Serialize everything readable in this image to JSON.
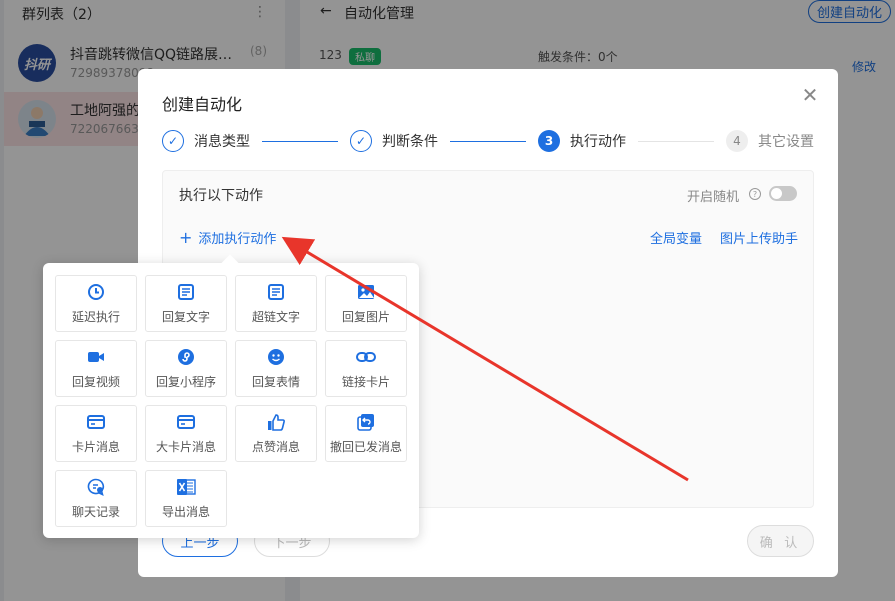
{
  "colors": {
    "accent": "#1e6fe0",
    "annotation_arrow": "#e8352b",
    "tag_green": "#19be6b"
  },
  "left_panel": {
    "title": "群列表（2）",
    "more_icon": "more-icon",
    "groups": [
      {
        "name": "抖音跳转微信QQ链路展…",
        "id": "72989378098",
        "count": "(8)",
        "avatar_text": "抖研"
      },
      {
        "name": "工地阿强的",
        "id": "72206766308",
        "count": ""
      }
    ]
  },
  "right_panel": {
    "back_icon": "arrow-left-icon",
    "title": "自动化管理",
    "create_button": "创建自动化",
    "row": {
      "id": "123",
      "tag": "私聊",
      "condition": "触发条件：0个",
      "edit": "修改"
    }
  },
  "modal": {
    "title": "创建自动化",
    "close_icon": "close-icon",
    "steps": [
      {
        "number": "1",
        "label": "消息类型",
        "state": "done"
      },
      {
        "number": "2",
        "label": "判断条件",
        "state": "done"
      },
      {
        "number": "3",
        "label": "执行动作",
        "state": "active"
      },
      {
        "number": "4",
        "label": "其它设置",
        "state": "todo"
      }
    ],
    "panel": {
      "title": "执行以下动作",
      "random_label": "开启随机",
      "random_on": false,
      "add_action": "添加执行动作",
      "global_var": "全局变量",
      "image_helper": "图片上传助手"
    },
    "buttons": {
      "prev": "上一步",
      "next": "下一步",
      "confirm": "确 认"
    }
  },
  "action_menu": [
    {
      "label": "延迟执行",
      "icon": "clock-icon"
    },
    {
      "label": "回复文字",
      "icon": "text-doc-icon"
    },
    {
      "label": "超链文字",
      "icon": "link-text-doc-icon"
    },
    {
      "label": "回复图片",
      "icon": "image-icon"
    },
    {
      "label": "回复视频",
      "icon": "video-icon"
    },
    {
      "label": "回复小程序",
      "icon": "mini-program-icon"
    },
    {
      "label": "回复表情",
      "icon": "emoji-icon"
    },
    {
      "label": "链接卡片",
      "icon": "link-icon"
    },
    {
      "label": "卡片消息",
      "icon": "card-icon"
    },
    {
      "label": "大卡片消息",
      "icon": "big-card-icon"
    },
    {
      "label": "点赞消息",
      "icon": "thumbs-up-icon"
    },
    {
      "label": "撤回已发消息",
      "icon": "recall-icon"
    },
    {
      "label": "聊天记录",
      "icon": "chat-history-icon"
    },
    {
      "label": "导出消息",
      "icon": "excel-export-icon"
    }
  ]
}
